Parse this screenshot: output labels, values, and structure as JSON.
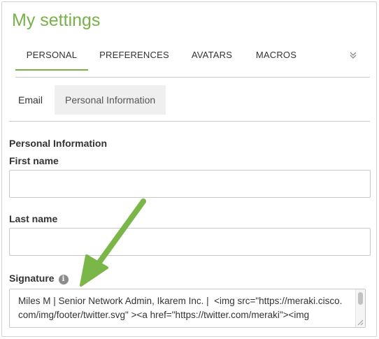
{
  "page": {
    "title": "My settings"
  },
  "tabs": [
    {
      "label": "PERSONAL",
      "active": true
    },
    {
      "label": "PREFERENCES",
      "active": false
    },
    {
      "label": "AVATARS",
      "active": false
    },
    {
      "label": "MACROS",
      "active": false
    }
  ],
  "more_icon": "chevron-double-down-icon",
  "subtabs": [
    {
      "label": "Email",
      "active": false
    },
    {
      "label": "Personal Information",
      "active": true
    }
  ],
  "form": {
    "section_heading": "Personal Information",
    "first_name": {
      "label": "First name",
      "value": ""
    },
    "last_name": {
      "label": "Last name",
      "value": ""
    },
    "signature": {
      "label": "Signature",
      "info_icon": "info-icon",
      "value": "Miles M | Senior Network Admin, Ikarem Inc. |  <img src=\"https://meraki.cisco.com/img/footer/twitter.svg\" ><a href=\"https://twitter.com/meraki\"><img"
    }
  },
  "colors": {
    "accent": "#78b04a",
    "annotation_arrow": "#7ab648"
  }
}
